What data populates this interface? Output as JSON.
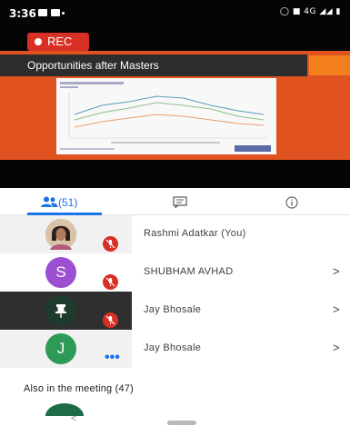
{
  "status_bar": {
    "time": "3:36",
    "network": "4G"
  },
  "recording": {
    "label": "REC",
    "color": "#d93025"
  },
  "presentation": {
    "slide_title": "Opportunities after Masters",
    "slide_color": "#e0521f"
  },
  "tabs": {
    "people_count": "(51)",
    "accent": "#1a73e8",
    "icons": [
      "people-icon",
      "chat-icon",
      "info-icon"
    ]
  },
  "participants": [
    {
      "name": "Rashmi Adatkar (You)",
      "avatar": "photo",
      "muted": true,
      "menu": false
    },
    {
      "name": "SHUBHAM AVHAD",
      "avatar_letter": "S",
      "avatar_color": "#9c4fd0",
      "muted": true,
      "menu": true
    },
    {
      "name": "Jay Bhosale",
      "avatar": "pin-icon",
      "muted": true,
      "menu": true,
      "pinned": true
    },
    {
      "name": "Jay Bhosale",
      "avatar_letter": "J",
      "avatar_color": "#2e9a57",
      "muted": false,
      "speaking": true,
      "menu": true
    }
  ],
  "others": {
    "label": "Also in the meeting (47)"
  },
  "nav": {
    "back_glyph": "<"
  }
}
